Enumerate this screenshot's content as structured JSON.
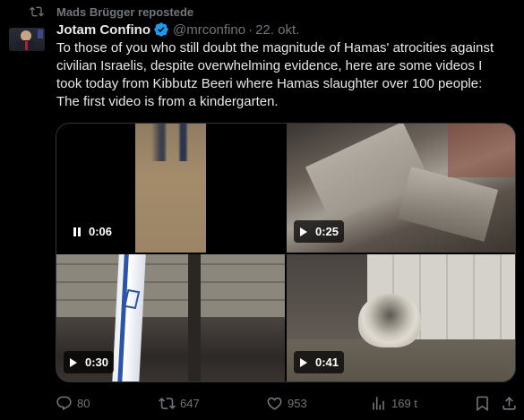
{
  "repost": {
    "icon": "repost-icon",
    "text": "Mads Brügger repostede"
  },
  "tweet": {
    "author_name": "Jotam Confino",
    "verified_icon": "verified-badge-icon",
    "handle": "@mrconfino",
    "separator": "·",
    "date": "22. okt.",
    "text_lines": [
      "To those of you who still doubt the magnitude of Hamas' atrocities against",
      "civilian Israelis, despite overwhelming evidence, here are some videos I",
      "took today from Kibbutz Beeri where Hamas slaughter over 100 people:",
      "The first video is from a kindergarten."
    ]
  },
  "media": {
    "videos": [
      {
        "control": "pause-icon",
        "duration": "0:06"
      },
      {
        "control": "play-icon",
        "duration": "0:25"
      },
      {
        "control": "play-icon",
        "duration": "0:30"
      },
      {
        "control": "play-icon",
        "duration": "0:41"
      }
    ]
  },
  "actions": {
    "reply": {
      "icon": "reply-icon",
      "count": "80"
    },
    "repost": {
      "icon": "repost-icon",
      "count": "647"
    },
    "like": {
      "icon": "heart-icon",
      "count": "953"
    },
    "views": {
      "icon": "views-chart-icon",
      "count": "169 t"
    },
    "bookmark": {
      "icon": "bookmark-icon"
    },
    "share": {
      "icon": "share-icon"
    }
  },
  "colors": {
    "background": "#000000",
    "text_primary": "#e7e9ea",
    "text_secondary": "#71767b",
    "verified": "#1d9bf0",
    "border": "#2f3336"
  }
}
